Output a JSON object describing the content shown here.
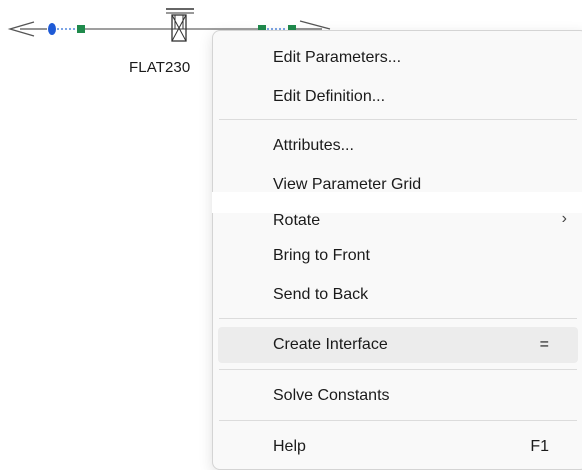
{
  "canvas": {
    "component_label": "FLAT230"
  },
  "context_menu": {
    "items": [
      {
        "label": "Edit Parameters..."
      },
      {
        "label": "Edit Definition..."
      },
      {
        "label": "Attributes..."
      },
      {
        "label": "View Parameter Grid"
      },
      {
        "label": "Rotate",
        "submenu": true
      },
      {
        "label": "Bring to Front"
      },
      {
        "label": "Send to Back"
      },
      {
        "label": "Create Interface",
        "shortcut": "=",
        "highlighted": true
      },
      {
        "label": "Solve Constants"
      },
      {
        "label": "Help",
        "shortcut": "F1"
      }
    ]
  },
  "colors": {
    "menu_background": "#f9f9f9",
    "menu_highlight": "#ececec",
    "node_blue": "#1e5ad6",
    "terminal_green": "#1f8a4c"
  },
  "icons": {
    "submenu_indicator": "chevron-right-icon",
    "tower": "transmission-tower-icon",
    "arrow_end": "arrow-end-icon"
  }
}
